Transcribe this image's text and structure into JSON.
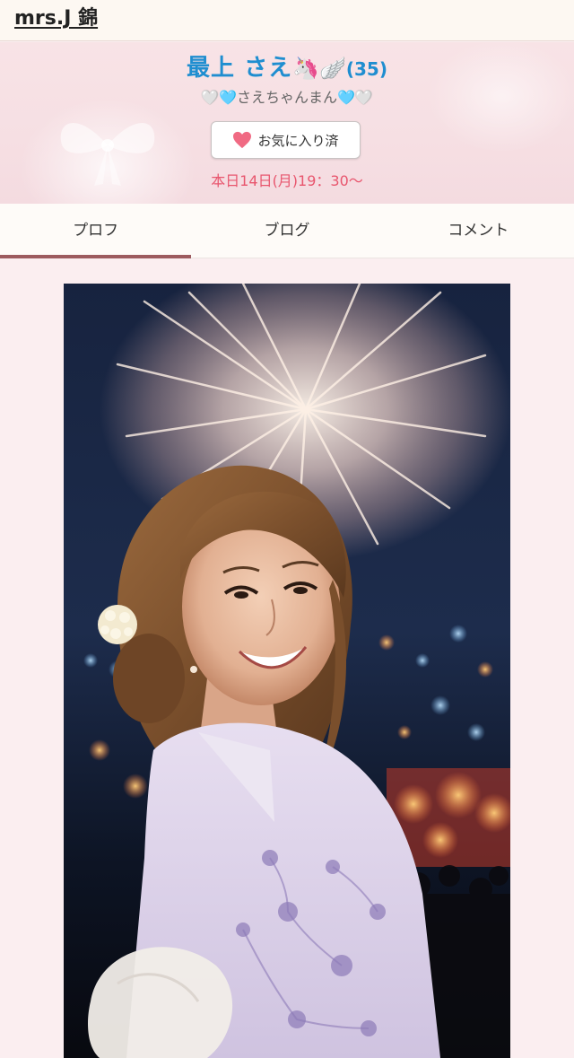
{
  "header": {
    "site_title": "mrs.J 錦"
  },
  "profile": {
    "name": "最上 さえ",
    "name_emojis": "🦄🪽",
    "age": "(35)",
    "catch_left_heart": "🤍",
    "catch_left_heart2": "🩵",
    "catch_text": "さえちゃんまん",
    "catch_right_heart": "🩵",
    "catch_right_heart2": "🤍",
    "favorite_label": "お気に入り済",
    "schedule": "本日14日(月)19：30〜"
  },
  "tabs": [
    {
      "label": "プロフ",
      "active": true
    },
    {
      "label": "ブログ",
      "active": false
    },
    {
      "label": "コメント",
      "active": false
    }
  ],
  "colors": {
    "name": "#1f8ed0",
    "schedule": "#e8566e",
    "tab_indicator": "#9d5b5f",
    "favorite_heart": "#f06a83"
  },
  "icons": {
    "favorite": "heart-icon"
  }
}
